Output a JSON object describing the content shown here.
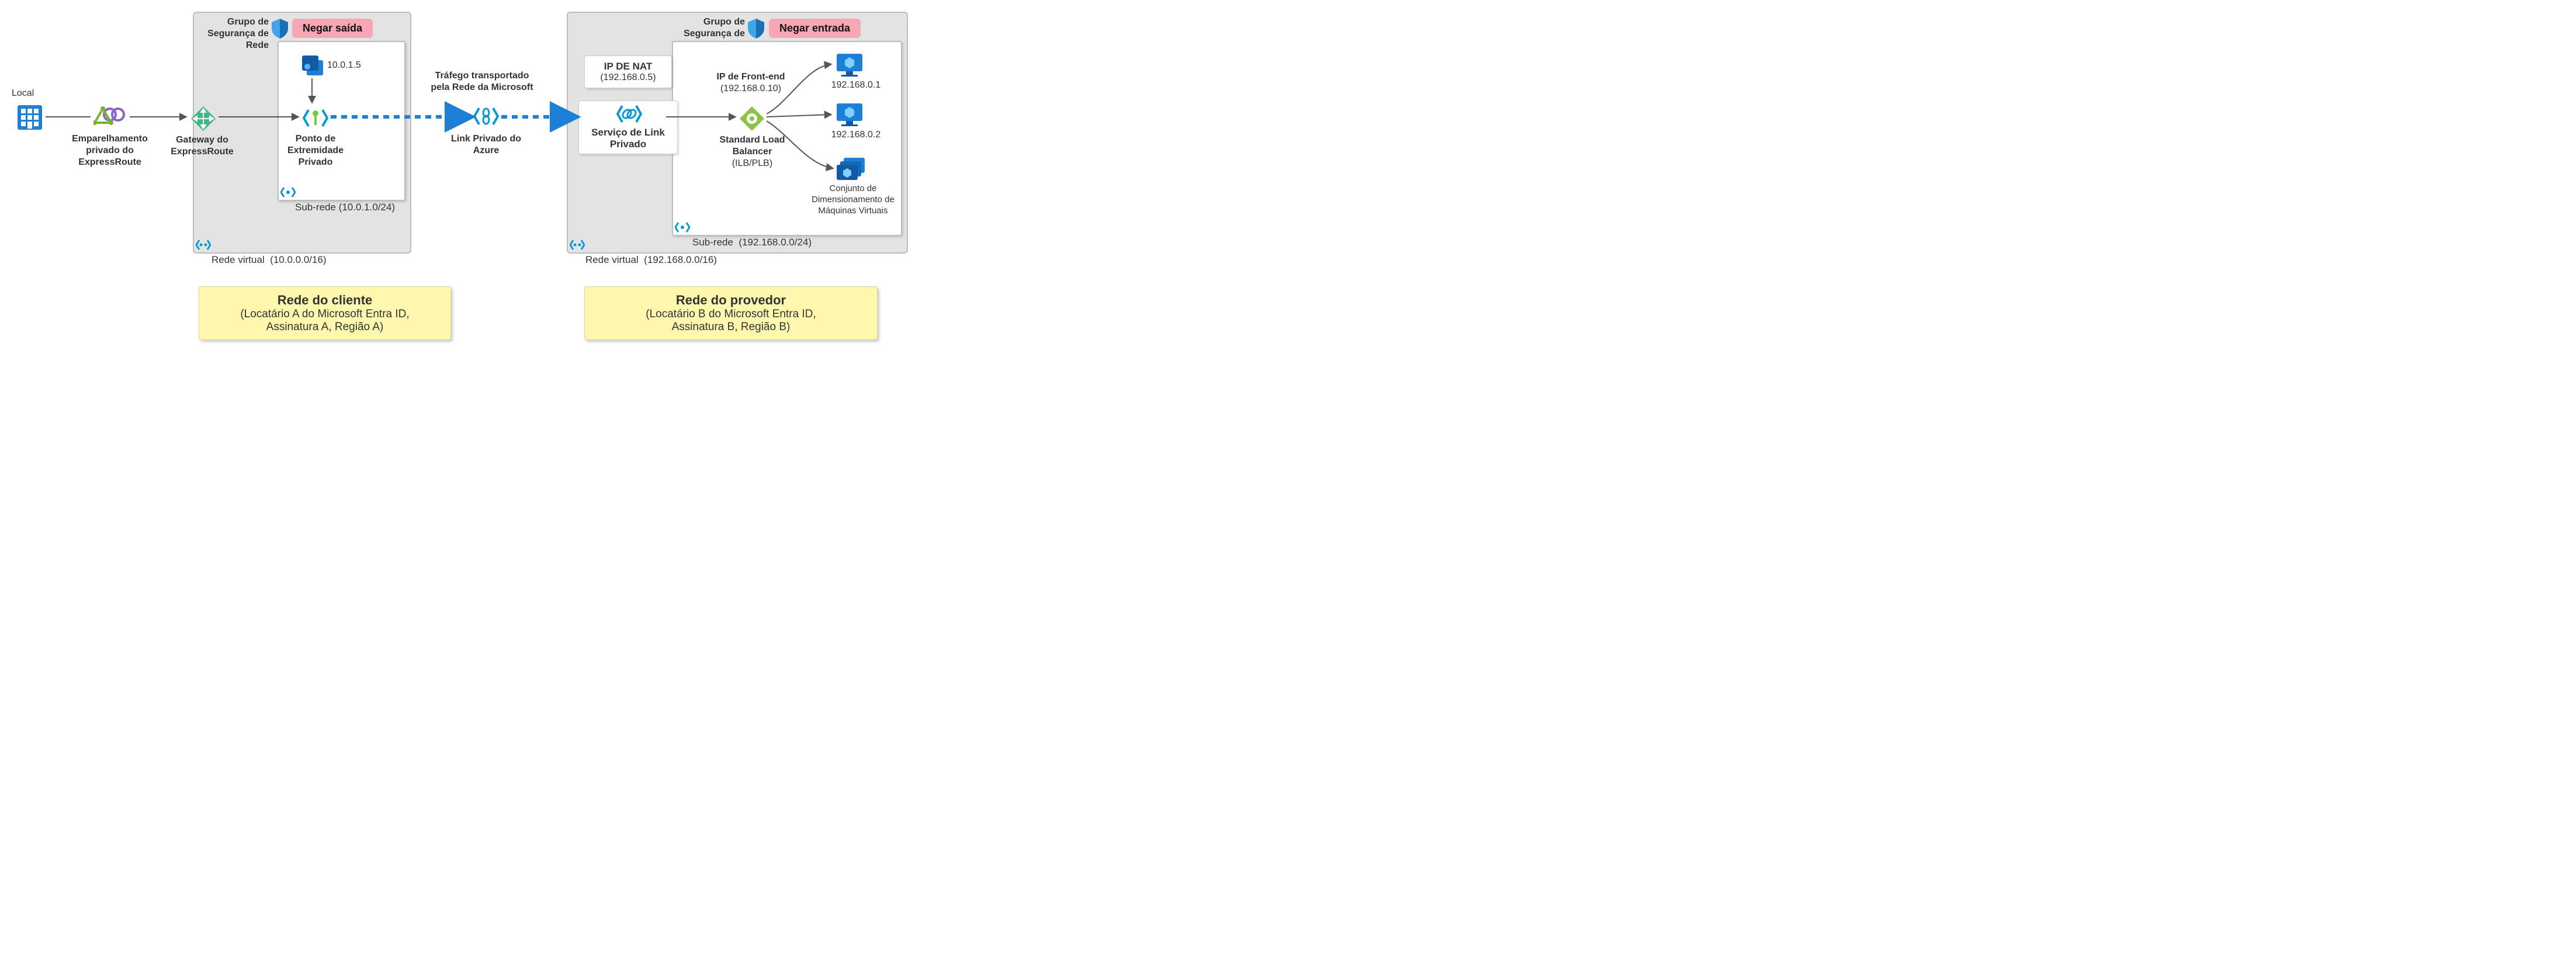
{
  "local_label": "Local",
  "peering_label": "Emparelhamento privado do ExpressRoute",
  "gateway_label": "Gateway do ExpressRoute",
  "pe_label": "Ponto de Extremidade Privado",
  "nic_ip": "10.0.1.5",
  "subnet_customer_label": "Sub-rede",
  "subnet_customer_cidr": "(10.0.1.0/24)",
  "nsg_label": "Grupo de Segurança de Rede",
  "deny_out": "Negar saída",
  "deny_in": "Negar entrada",
  "vnet_label": "Rede virtual",
  "vnet_customer_cidr": "(10.0.0.0/16)",
  "vnet_provider_cidr": "(192.168.0.0/16)",
  "backbone_top": "Tráfego transportado",
  "backbone_bot": "pela Rede da Microsoft",
  "pl_label": "Link Privado do Azure",
  "nat_title": "IP DE NAT",
  "nat_ip": "(192.168.0.5)",
  "pls_title": "Serviço de Link Privado",
  "frontend_title": "IP de Front-end",
  "frontend_ip": "(192.168.0.10)",
  "slb_title": "Standard Load Balancer",
  "slb_sub": "(ILB/PLB)",
  "vm1_ip": "192.168.0.1",
  "vm2_ip": "192.168.0.2",
  "vmss_label": "Conjunto de Dimensionamento de Máquinas Virtuais",
  "subnet_provider_label": "Sub-rede",
  "subnet_provider_cidr": "(192.168.0.0/24)",
  "customer_title": "Rede do cliente",
  "customer_sub1": "(Locatário A do Microsoft Entra ID,",
  "customer_sub2": "Assinatura A, Região A)",
  "provider_title": "Rede do provedor",
  "provider_sub1": "(Locatário B do Microsoft Entra ID,",
  "provider_sub2": "Assinatura B, Região B)",
  "chart_data": {
    "type": "diagram",
    "nodes": [
      {
        "id": "local",
        "label": "Local"
      },
      {
        "id": "peering",
        "label": "Emparelhamento privado do ExpressRoute"
      },
      {
        "id": "gateway",
        "label": "Gateway do ExpressRoute"
      },
      {
        "id": "nic",
        "label": "10.0.1.5"
      },
      {
        "id": "pe",
        "label": "Ponto de Extremidade Privado"
      },
      {
        "id": "pl",
        "label": "Link Privado do Azure"
      },
      {
        "id": "nat",
        "label": "IP DE NAT (192.168.0.5)"
      },
      {
        "id": "pls",
        "label": "Serviço de Link Privado"
      },
      {
        "id": "slb",
        "label": "Standard Load Balancer (ILB/PLB)",
        "frontend_ip": "192.168.0.10"
      },
      {
        "id": "vm1",
        "label": "192.168.0.1"
      },
      {
        "id": "vm2",
        "label": "192.168.0.2"
      },
      {
        "id": "vmss",
        "label": "Conjunto de Dimensionamento de Máquinas Virtuais"
      }
    ],
    "edges": [
      [
        "local",
        "peering",
        "solid"
      ],
      [
        "peering",
        "gateway",
        "solid"
      ],
      [
        "gateway",
        "pe",
        "solid"
      ],
      [
        "nic",
        "pe",
        "solid"
      ],
      [
        "pe",
        "pl",
        "dashed"
      ],
      [
        "pl",
        "pls",
        "dashed"
      ],
      [
        "pls",
        "slb",
        "solid"
      ],
      [
        "slb",
        "vm1",
        "solid"
      ],
      [
        "slb",
        "vm2",
        "solid"
      ],
      [
        "slb",
        "vmss",
        "solid"
      ]
    ],
    "groups": [
      {
        "id": "customer_nsg",
        "label": "Grupo de Segurança de Rede",
        "badge": "Negar saída",
        "contains": [
          "customer_subnet",
          "gateway"
        ]
      },
      {
        "id": "customer_subnet",
        "label": "Sub-rede (10.0.1.0/24)",
        "contains": [
          "nic",
          "pe"
        ]
      },
      {
        "id": "customer_vnet",
        "label": "Rede virtual (10.0.0.0/16)",
        "contains": [
          "customer_nsg"
        ]
      },
      {
        "id": "provider_nsg",
        "label": "Grupo de Segurança de Rede",
        "badge": "Negar entrada",
        "contains": [
          "provider_subnet",
          "pls",
          "nat"
        ]
      },
      {
        "id": "provider_subnet",
        "label": "Sub-rede (192.168.0.0/24)",
        "contains": [
          "slb",
          "vm1",
          "vm2",
          "vmss"
        ]
      },
      {
        "id": "provider_vnet",
        "label": "Rede virtual (192.168.0.0/16)",
        "contains": [
          "provider_nsg"
        ]
      }
    ],
    "regions": [
      {
        "id": "customer",
        "title": "Rede do cliente",
        "subtitle": "(Locatário A do Microsoft Entra ID, Assinatura A, Região A)"
      },
      {
        "id": "provider",
        "title": "Rede do provedor",
        "subtitle": "(Locatário B do Microsoft Entra ID, Assinatura B, Região B)"
      }
    ],
    "backbone_label": "Tráfego transportado pela Rede da Microsoft"
  }
}
